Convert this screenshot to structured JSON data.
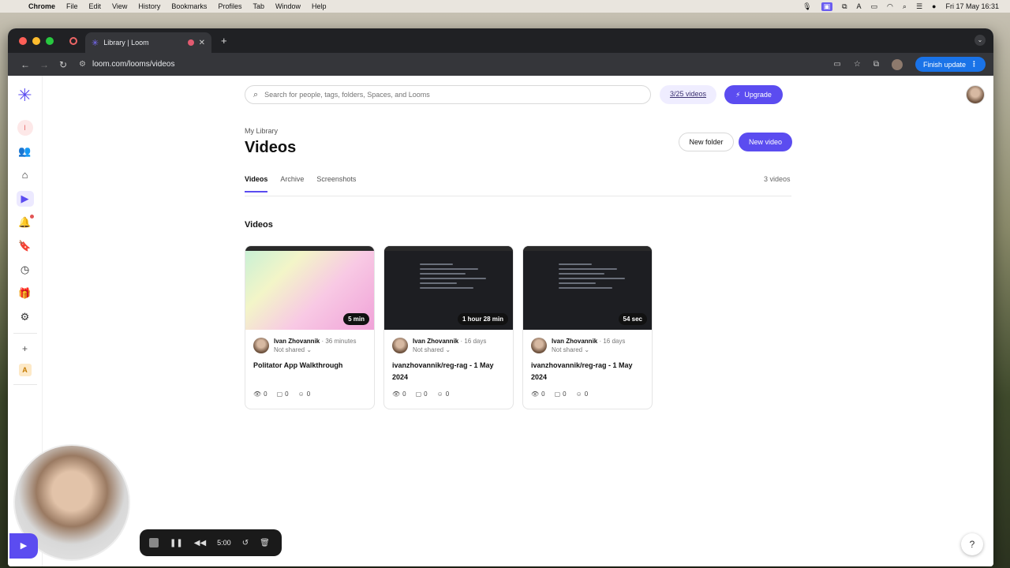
{
  "menubar": {
    "app": "Chrome",
    "items": [
      "File",
      "Edit",
      "View",
      "History",
      "Bookmarks",
      "Profiles",
      "Tab",
      "Window",
      "Help"
    ],
    "datetime": "Fri 17 May  16:31"
  },
  "browser": {
    "tab_title": "Library | Loom",
    "url": "loom.com/looms/videos",
    "finish_update": "Finish update"
  },
  "header": {
    "search_placeholder": "Search for people, tags, folders, Spaces, and Looms",
    "quota": "3/25 videos",
    "upgrade": "Upgrade"
  },
  "sidebar": {
    "workspace_initial": "I",
    "workspace_alt_initial": "A"
  },
  "library": {
    "breadcrumb": "My Library",
    "title": "Videos",
    "new_folder": "New folder",
    "new_video": "New video",
    "tabs": [
      "Videos",
      "Archive",
      "Screenshots"
    ],
    "count": "3 videos",
    "section_title": "Videos"
  },
  "videos": [
    {
      "author": "Ivan Zhovannik",
      "ago": "36 minutes",
      "shared": "Not shared",
      "title": "Politator App Walkthrough",
      "duration": "5 min",
      "views": "0",
      "comments": "0",
      "reactions": "0"
    },
    {
      "author": "Ivan Zhovannik",
      "ago": "16 days",
      "shared": "Not shared",
      "title": "ivanzhovannik/reg-rag - 1 May 2024",
      "duration": "1 hour 28 min",
      "views": "0",
      "comments": "0",
      "reactions": "0"
    },
    {
      "author": "Ivan Zhovannik",
      "ago": "16 days",
      "shared": "Not shared",
      "title": "ivanzhovannik/reg-rag - 1 May 2024",
      "duration": "54 sec",
      "views": "0",
      "comments": "0",
      "reactions": "0"
    }
  ],
  "recorder": {
    "time": "5:00"
  },
  "help": "?"
}
